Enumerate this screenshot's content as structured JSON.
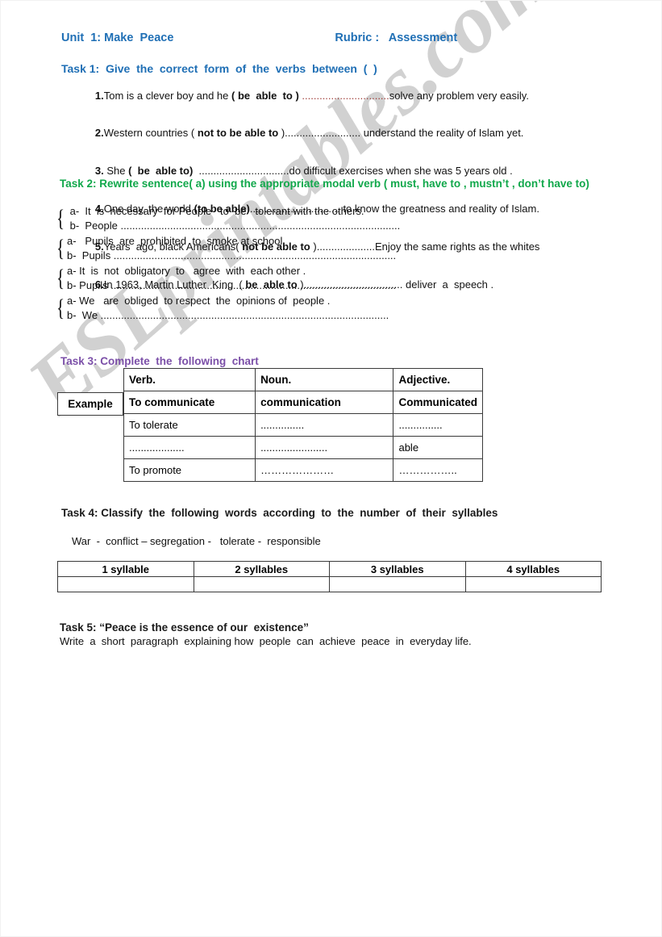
{
  "header": {
    "unit": "Unit  1: Make  Peace",
    "rubric": "Rubric :   Assessment"
  },
  "task1": {
    "heading": "Task 1:  Give  the  correct  form  of  the  verbs  between  (  )",
    "items": [
      {
        "number": "1.",
        "before": "Tom is a clever boy and he ",
        "cue": "( be  able  to )",
        "dots": " ..............................",
        "after": "solve any problem very easily.",
        "dots_color": "red"
      },
      {
        "number": "2.",
        "before": "Western countries ( ",
        "cue": "not to be able to",
        "dots": " )..........................",
        "after": " understand the reality of Islam yet.",
        "dots_color": "black"
      },
      {
        "number": "3.",
        "before": " She ",
        "cue": "(  be  able to)",
        "dots": "  ...............................",
        "after": "do difficult exercises when she was 5 years old .",
        "dots_color": "black"
      },
      {
        "number": "4.",
        "before": "One day, the world ",
        "cue": "(to be able)",
        "dots": "...............................",
        "after": " to know the greatness and reality of Islam.",
        "dots_color": "black"
      },
      {
        "number": "5.",
        "before": "Years  ago, black Americans( ",
        "cue": "not be able to",
        "dots": " )....................",
        "after": "Enjoy the same rights as the whites",
        "dots_color": "black"
      },
      {
        "number": "6.",
        "before": "In 1963, Martin Luther  King  ( ",
        "cue": "be  able to",
        "dots": " )..................................",
        "after": " deliver  a  speech .",
        "dots_color": "black"
      }
    ]
  },
  "task2": {
    "heading": "Task 2: Rewrite  sentence( a)   using  the  appropriate modal verb ( must, have to ,  mustn’t ,  don’t  have  to)",
    "pairs": [
      {
        "a": " a-  It  is  necessary  for People   to  be   tolerant with the others.",
        "b": " b-  People ................................................................................................"
      },
      {
        "a": "a-   Pupils  are  prohibited  to  smoke at school",
        "b": "b-  Pupils ................................................................................................."
      },
      {
        "a": "a- It  is  not  obligatory  to   agree  with  each other .",
        "b": "b- Pupils .................................................................................................."
      },
      {
        "a": "a- We   are  obliged  to respect  the  opinions of  people .",
        "b": "b-  We ..................................................................................................."
      }
    ]
  },
  "task3": {
    "heading": "Task 3: Complete  the  following  chart",
    "example_label": "Example",
    "columns": [
      "Verb.",
      "Noun.",
      "Adjective."
    ],
    "rows": [
      [
        "To communicate",
        "communication",
        "Communicated"
      ],
      [
        "To tolerate",
        "...............",
        "..............."
      ],
      [
        "...................",
        ".......................",
        "able"
      ],
      [
        "To promote",
        "…………………",
        "…………….."
      ]
    ]
  },
  "task4": {
    "heading": "Task 4: Classify  the  following  words  according  to  the  number  of  their  syllables",
    "words": "War  -  conflict – segregation -   tolerate -  responsible",
    "columns": [
      "1 syllable",
      "2 syllables",
      "3 syllables",
      "4 syllables"
    ],
    "answer_row": [
      "",
      "",
      "",
      ""
    ]
  },
  "task5": {
    "heading": "Task 5: “Peace is the essence of our  existence”",
    "body": "Write  a  short  paragraph  explaining how  people  can  achieve  peace  in  everyday life."
  },
  "watermark": {
    "text": "ESLprintables.com"
  },
  "colors": {
    "blue": "#1f6fb5",
    "green": "#11a84b",
    "purple": "#7b4fa8",
    "red_dots": "#9e3b36",
    "watermark": "#c9c9c9"
  }
}
